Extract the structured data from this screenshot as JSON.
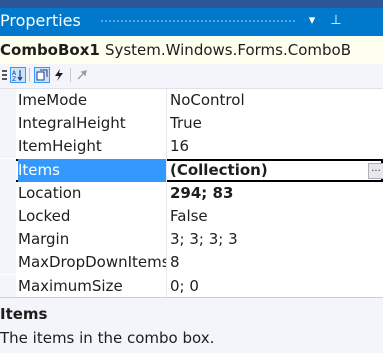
{
  "panel": {
    "title": "Properties",
    "dropdown_glyph": "▾",
    "pin_glyph": "⊥"
  },
  "object_selector": {
    "name": "ComboBox1",
    "type": "System.Windows.Forms.ComboB"
  },
  "toolbar": {
    "buttons": [
      {
        "name": "categorized-icon"
      },
      {
        "name": "alphabetical-icon",
        "active": true
      },
      {
        "name": "properties-icon",
        "active": true
      },
      {
        "name": "events-icon"
      },
      {
        "name": "property-pages-icon"
      }
    ]
  },
  "properties": [
    {
      "name": "ImeMode",
      "value": "NoControl"
    },
    {
      "name": "IntegralHeight",
      "value": "True"
    },
    {
      "name": "ItemHeight",
      "value": "16"
    },
    {
      "name": "Items",
      "value": "(Collection)",
      "bold": true,
      "selected": true,
      "has_button": true,
      "button_label": "..."
    },
    {
      "name": "Location",
      "value": "294; 83",
      "bold": true
    },
    {
      "name": "Locked",
      "value": "False"
    },
    {
      "name": "Margin",
      "value": "3; 3; 3; 3"
    },
    {
      "name": "MaxDropDownItems",
      "value": "8"
    },
    {
      "name": "MaximumSize",
      "value": "0; 0"
    }
  ],
  "description": {
    "title": "Items",
    "text": "The items in the combo box."
  },
  "colors": {
    "titlebar": "#0079cc",
    "selection": "#3399ff",
    "background": "#2b579a"
  }
}
